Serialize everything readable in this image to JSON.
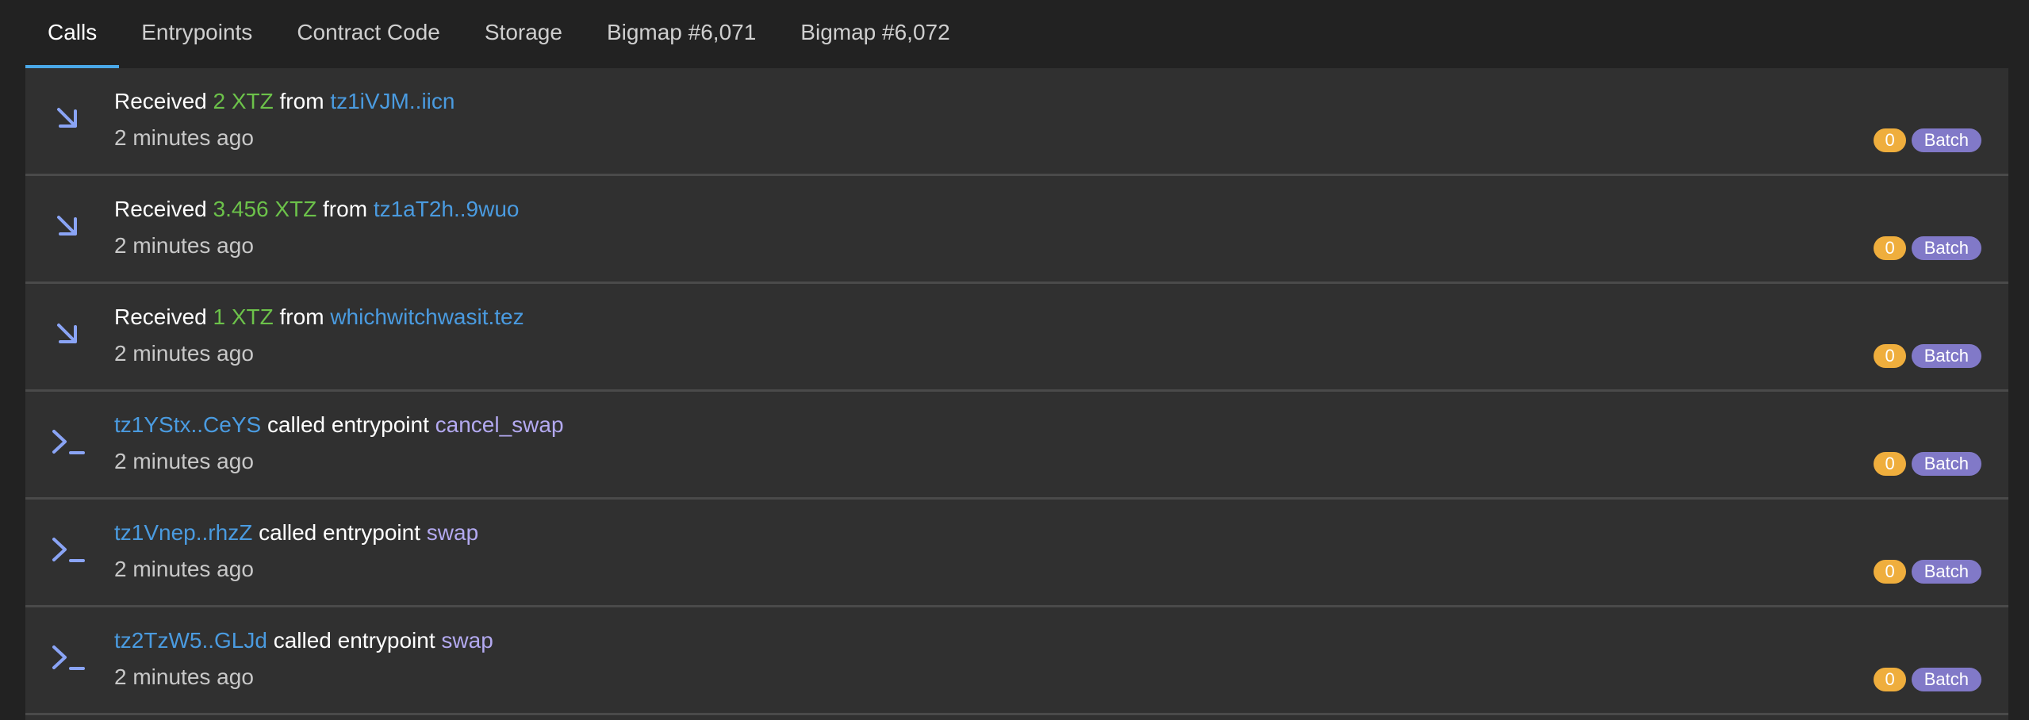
{
  "tabs": [
    {
      "label": "Calls",
      "active": true
    },
    {
      "label": "Entrypoints",
      "active": false
    },
    {
      "label": "Contract Code",
      "active": false
    },
    {
      "label": "Storage",
      "active": false
    },
    {
      "label": "Bigmap #6,071",
      "active": false
    },
    {
      "label": "Bigmap #6,072",
      "active": false
    }
  ],
  "colors": {
    "accent": "#4aa8e8",
    "amount": "#6cc24a",
    "address": "#4a9be0",
    "entrypoint": "#b3a9f0",
    "count_badge": "#efae3d",
    "type_badge": "#8179c8",
    "icon": "#8aa4f5"
  },
  "rows": [
    {
      "kind": "received",
      "icon": "arrow-down-right-icon",
      "prefix": "Received ",
      "amount": "2 XTZ",
      "middle": " from ",
      "address": "tz1iVJM..iicn",
      "time": "2 minutes ago",
      "count": "0",
      "type": "Batch"
    },
    {
      "kind": "received",
      "icon": "arrow-down-right-icon",
      "prefix": "Received ",
      "amount": "3.456 XTZ",
      "middle": " from ",
      "address": "tz1aT2h..9wuo",
      "time": "2 minutes ago",
      "count": "0",
      "type": "Batch"
    },
    {
      "kind": "received",
      "icon": "arrow-down-right-icon",
      "prefix": "Received ",
      "amount": "1 XTZ",
      "middle": " from ",
      "address": "whichwitchwasit.tez",
      "time": "2 minutes ago",
      "count": "0",
      "type": "Batch"
    },
    {
      "kind": "call",
      "icon": "terminal-prompt-icon",
      "address": "tz1YStx..CeYS",
      "middle": " called entrypoint ",
      "entrypoint": "cancel_swap",
      "time": "2 minutes ago",
      "count": "0",
      "type": "Batch"
    },
    {
      "kind": "call",
      "icon": "terminal-prompt-icon",
      "address": "tz1Vnep..rhzZ",
      "middle": " called entrypoint ",
      "entrypoint": "swap",
      "time": "2 minutes ago",
      "count": "0",
      "type": "Batch"
    },
    {
      "kind": "call",
      "icon": "terminal-prompt-icon",
      "address": "tz2TzW5..GLJd",
      "middle": " called entrypoint ",
      "entrypoint": "swap",
      "time": "2 minutes ago",
      "count": "0",
      "type": "Batch"
    }
  ]
}
